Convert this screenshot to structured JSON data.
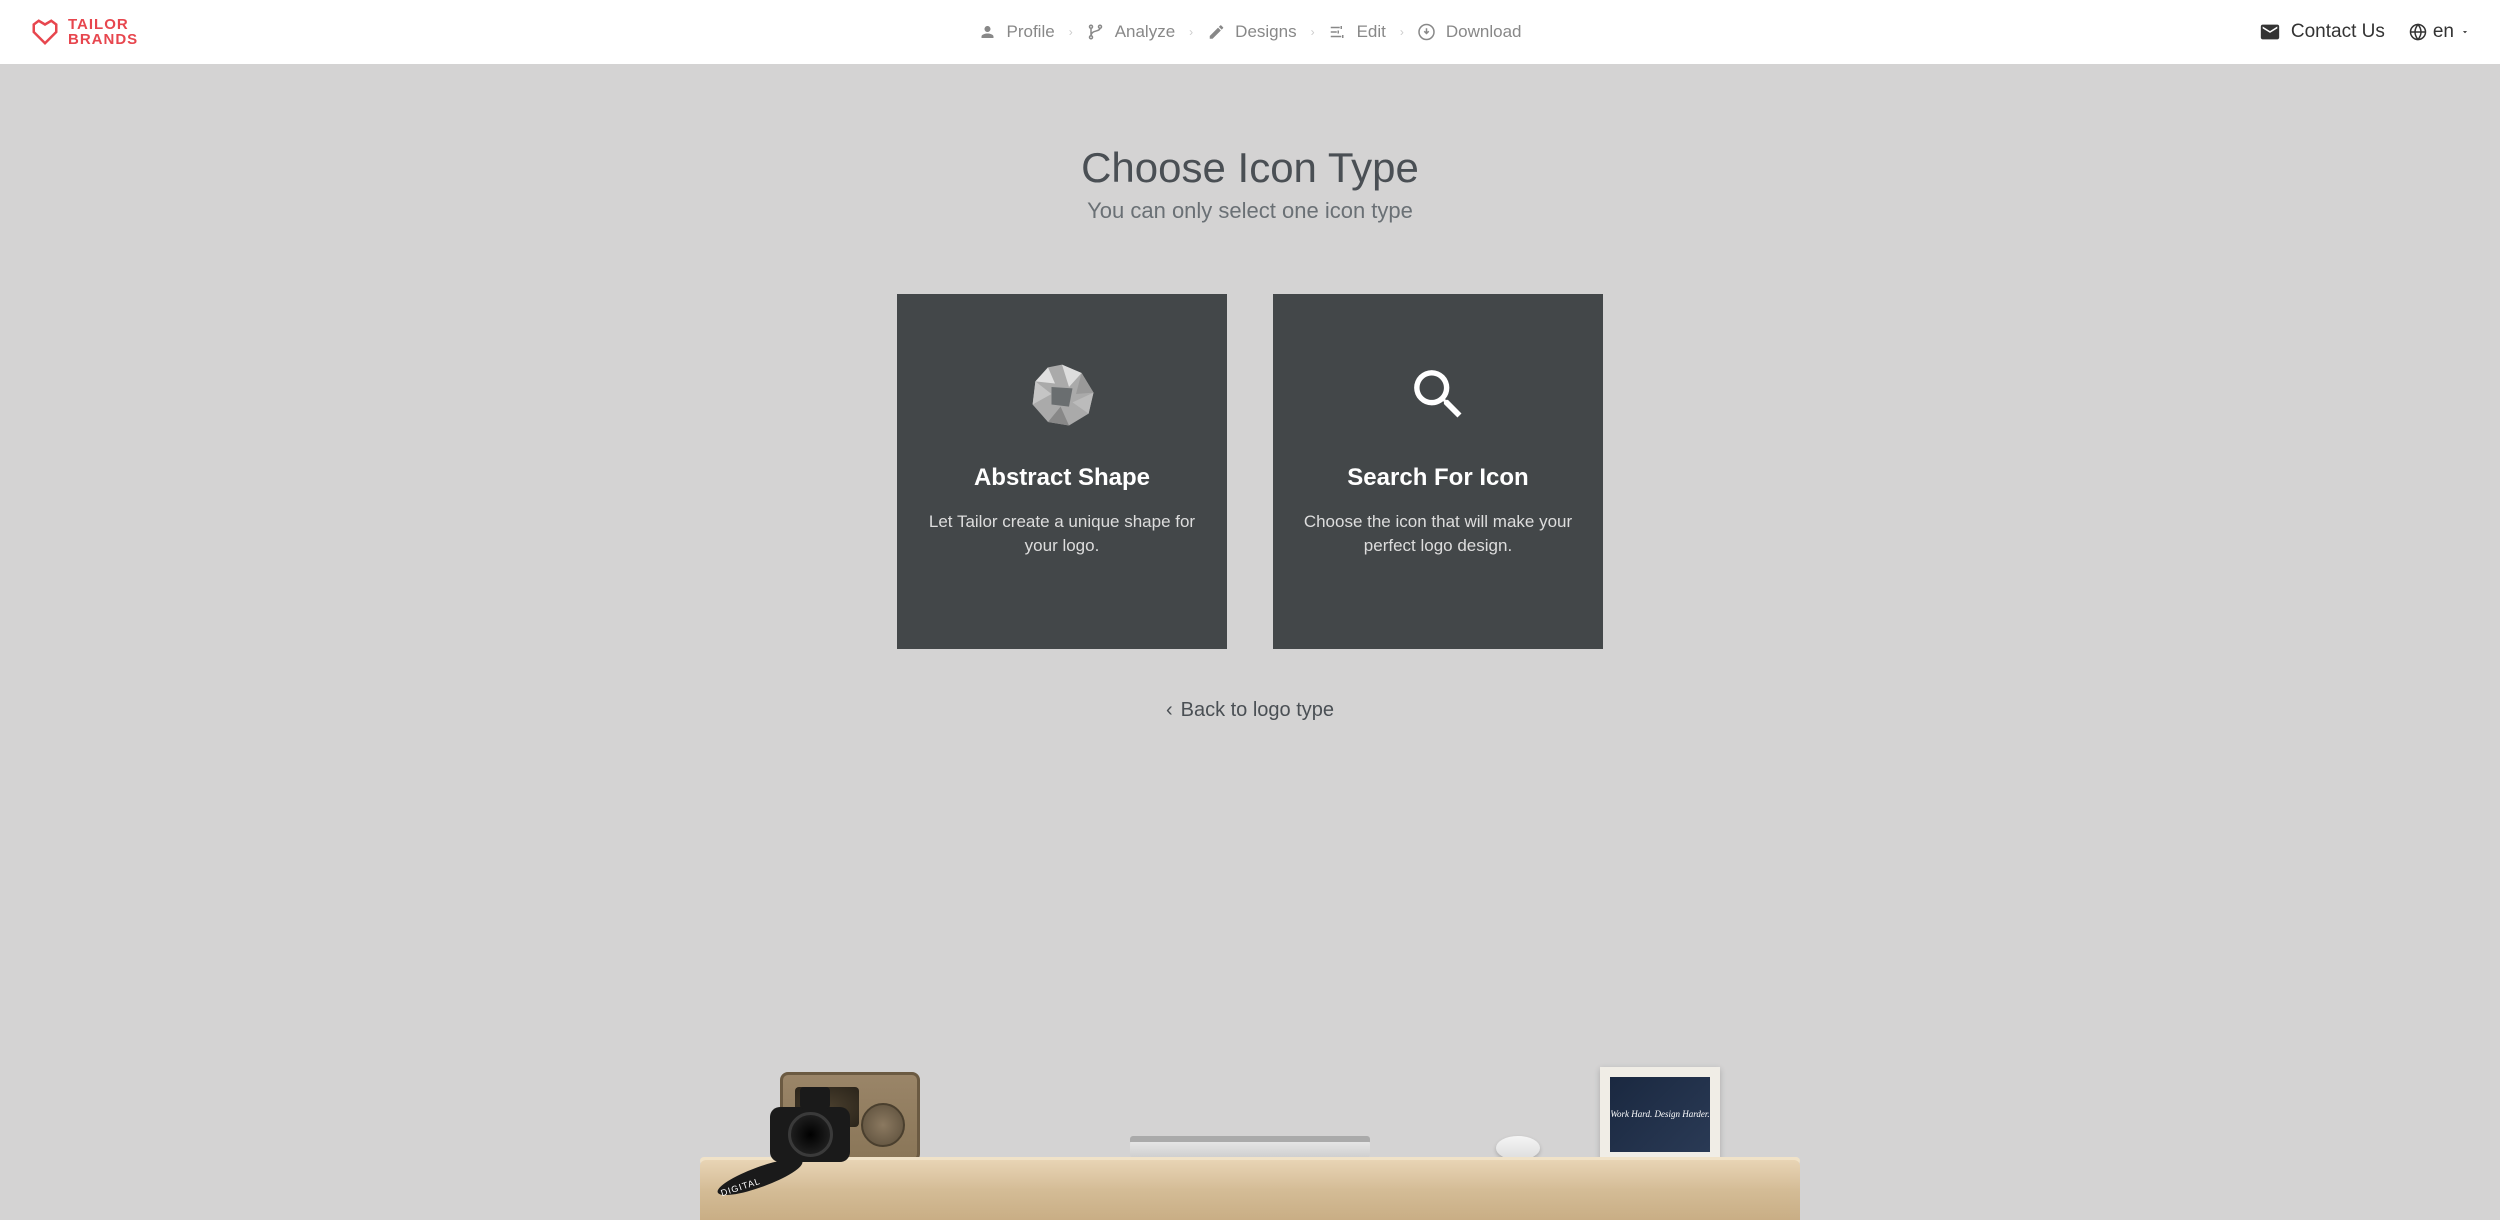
{
  "brand": {
    "line1": "TAILOR",
    "line2": "BRANDS"
  },
  "nav": {
    "steps": [
      {
        "label": "Profile"
      },
      {
        "label": "Analyze"
      },
      {
        "label": "Designs"
      },
      {
        "label": "Edit"
      },
      {
        "label": "Download"
      }
    ]
  },
  "header": {
    "contact": "Contact Us",
    "lang": "en"
  },
  "main": {
    "title": "Choose Icon Type",
    "subtitle": "You can only select one icon type",
    "options": [
      {
        "title": "Abstract Shape",
        "desc": "Let Tailor create a unique shape for your logo."
      },
      {
        "title": "Search For Icon",
        "desc": "Choose the icon that will make your perfect logo design."
      }
    ],
    "back": "Back to logo type"
  },
  "desk": {
    "strap_label": "DIGITAL",
    "frame_text": "Work Hard.\nDesign Harder."
  }
}
